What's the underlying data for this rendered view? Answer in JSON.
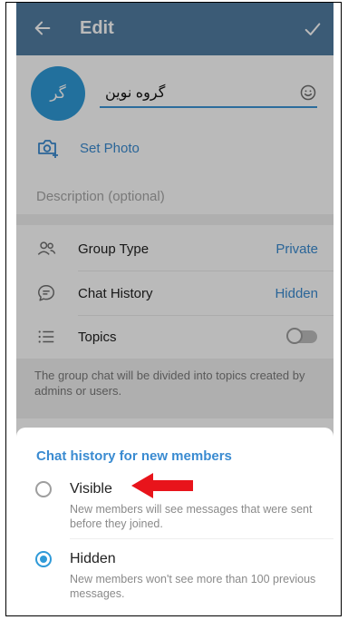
{
  "header": {
    "title": "Edit",
    "back_icon": "arrow-left-icon",
    "done_icon": "checkmark-icon"
  },
  "group": {
    "avatar_initials": "گر",
    "name_value": "گروه نوین",
    "emoji_icon": "emoji-icon"
  },
  "set_photo": {
    "label": "Set Photo",
    "icon": "camera-plus-icon"
  },
  "description": {
    "placeholder": "Description (optional)"
  },
  "settings": {
    "group_type": {
      "label": "Group Type",
      "value": "Private",
      "icon": "people-icon"
    },
    "chat_history": {
      "label": "Chat History",
      "value": "Hidden",
      "icon": "chat-bubble-icon"
    },
    "topics": {
      "label": "Topics",
      "toggle_on": false,
      "icon": "list-icon"
    }
  },
  "topics_info": "The group chat will be divided into topics created by admins or users.",
  "sheet": {
    "title": "Chat history for new members",
    "options": [
      {
        "label": "Visible",
        "desc": "New members will see messages that were sent before they joined.",
        "selected": false
      },
      {
        "label": "Hidden",
        "desc": "New members won't see more than 100 previous messages.",
        "selected": true
      }
    ]
  },
  "colors": {
    "header": "#517da2",
    "accent": "#3a8bd1",
    "avatar": "#2f9ad8",
    "arrow": "#e8141b"
  }
}
